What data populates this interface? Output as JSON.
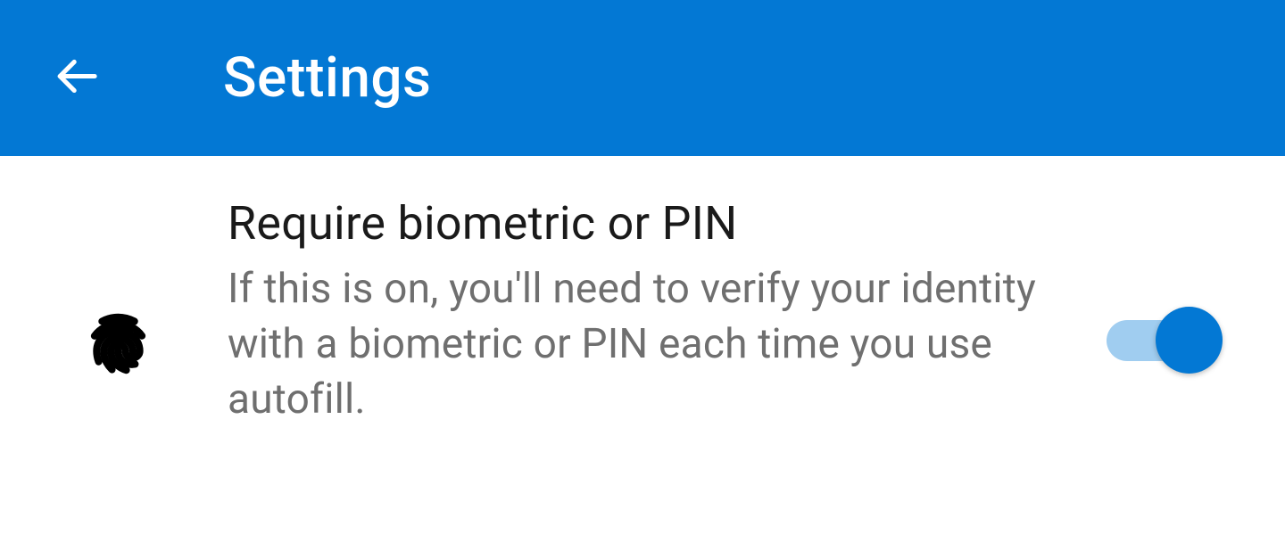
{
  "header": {
    "title": "Settings"
  },
  "setting": {
    "title": "Require biometric or PIN",
    "description": "If this is on, you'll need to verify your identity with a biometric or PIN each time you use autofill.",
    "toggle_on": true
  },
  "colors": {
    "primary": "#0378d4",
    "toggle_track": "#a0cdf0",
    "text_primary": "#1a1a1a",
    "text_secondary": "#6f6f6f"
  }
}
